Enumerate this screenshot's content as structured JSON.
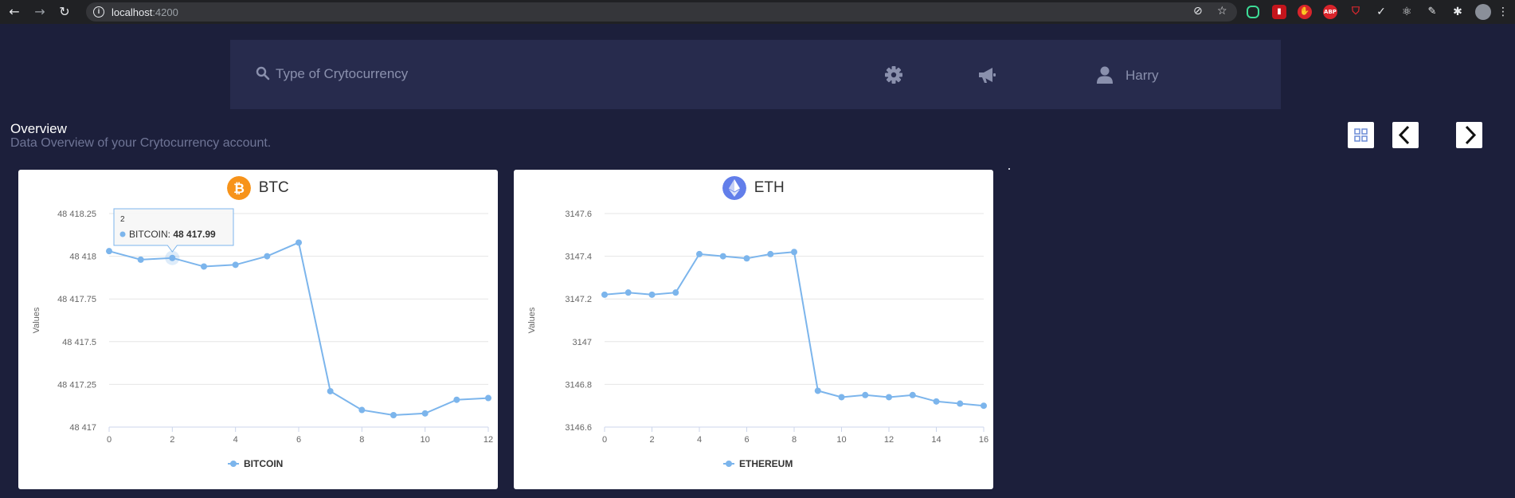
{
  "browser": {
    "url_host": "localhost",
    "url_port": ":4200"
  },
  "header": {
    "search_placeholder": "Type of Crytocurrency",
    "user_name": "Harry",
    "icons": [
      "search-icon",
      "gear-icon",
      "megaphone-icon",
      "user-icon"
    ]
  },
  "overview": {
    "title": "Overview",
    "subtitle": "Data Overview of your Crytocurrency account."
  },
  "controls": [
    "grid-view-icon",
    "chevron-left-icon",
    "chevron-right-icon"
  ],
  "colors": {
    "background": "#1c1f3b",
    "panel": "#272b4d",
    "series": "#7cb5ec",
    "btc": "#f7931a",
    "eth": "#627eea"
  },
  "cards": [
    {
      "coin_label": "BTC",
      "icon": "bitcoin-icon",
      "tooltip": {
        "x": "2",
        "series": "BITCOIN",
        "value": "48 417.99"
      }
    },
    {
      "coin_label": "ETH",
      "icon": "ethereum-icon"
    }
  ],
  "chart_data": [
    {
      "type": "line",
      "title": "BTC",
      "xlabel": "",
      "ylabel": "Values",
      "xlim": [
        0,
        12
      ],
      "ylim": [
        48417,
        48418.25
      ],
      "x_ticks": [
        "0",
        "2",
        "4",
        "6",
        "8",
        "10",
        "12"
      ],
      "y_ticks": [
        "48 417",
        "48 417.25",
        "48 417.5",
        "48 417.75",
        "48 418",
        "48 418.25"
      ],
      "grid": true,
      "legend": "bottom",
      "series": [
        {
          "name": "BITCOIN",
          "x": [
            0,
            1,
            2,
            3,
            4,
            5,
            6,
            7,
            8,
            9,
            10,
            11,
            12
          ],
          "values": [
            48418.03,
            48417.98,
            48417.99,
            48417.94,
            48417.95,
            48418.0,
            48418.08,
            48417.21,
            48417.1,
            48417.07,
            48417.08,
            48417.16,
            48417.17
          ]
        }
      ]
    },
    {
      "type": "line",
      "title": "ETH",
      "xlabel": "",
      "ylabel": "Values",
      "xlim": [
        0,
        16
      ],
      "ylim": [
        3146.6,
        3147.6
      ],
      "x_ticks": [
        "0",
        "2",
        "4",
        "6",
        "8",
        "10",
        "12",
        "14",
        "16"
      ],
      "y_ticks": [
        "3146.6",
        "3146.8",
        "3147",
        "3147.2",
        "3147.4",
        "3147.6"
      ],
      "grid": true,
      "legend": "bottom",
      "series": [
        {
          "name": "ETHEREUM",
          "x": [
            0,
            1,
            2,
            3,
            4,
            5,
            6,
            7,
            8,
            9,
            10,
            11,
            12,
            13,
            14,
            15,
            16
          ],
          "values": [
            3147.22,
            3147.23,
            3147.22,
            3147.23,
            3147.41,
            3147.4,
            3147.39,
            3147.41,
            3147.42,
            3146.77,
            3146.74,
            3146.75,
            3146.74,
            3146.75,
            3146.72,
            3146.71,
            3146.7
          ]
        }
      ]
    }
  ]
}
